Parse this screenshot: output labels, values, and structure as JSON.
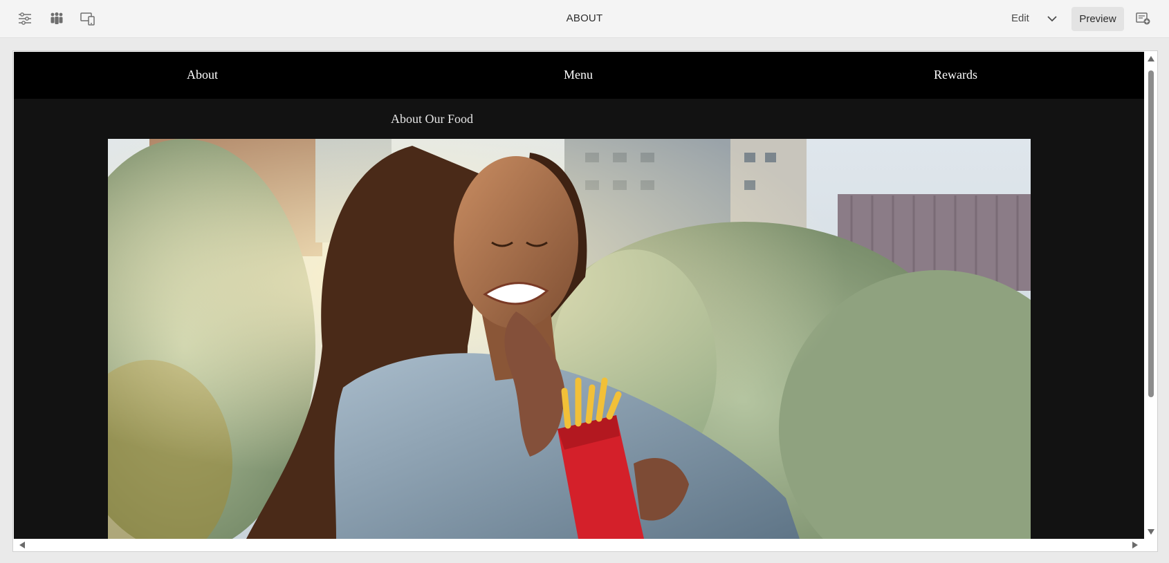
{
  "toolbar": {
    "title": "ABOUT",
    "edit_label": "Edit",
    "preview_label": "Preview",
    "icons": [
      "page-properties-icon",
      "people-icon",
      "emulator-icon",
      "chevron-down-icon",
      "annotations-icon"
    ]
  },
  "site": {
    "nav": [
      "About",
      "Menu",
      "Rewards"
    ],
    "section_title": "About Our Food",
    "hero_image": "woman-eating-fries-photo"
  },
  "colors": {
    "toolbar_bg": "#f4f4f4",
    "nav_bg": "#000000",
    "page_bg": "#121212",
    "preview_button_bg": "#e3e3e3"
  }
}
